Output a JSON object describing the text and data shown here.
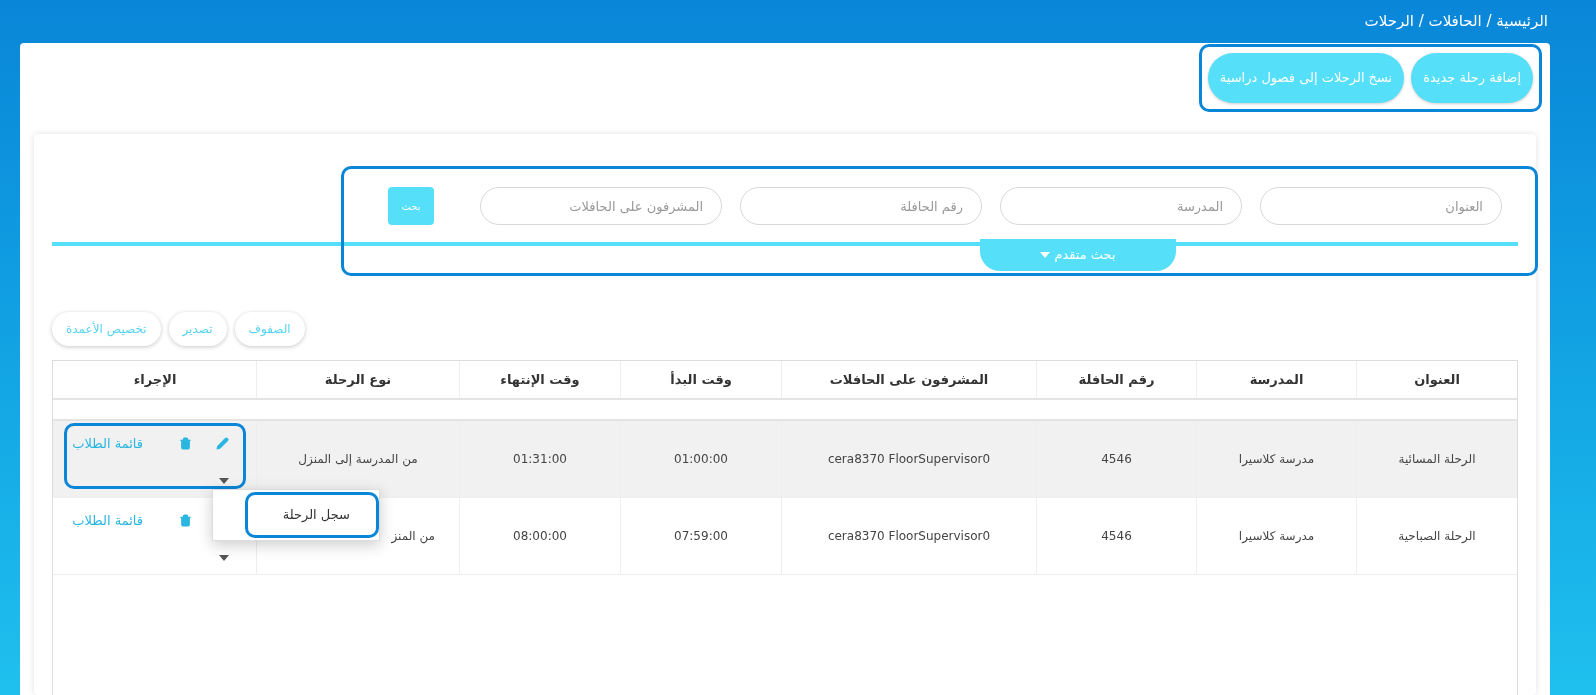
{
  "breadcrumb": "الرئيسية / الحافلات / الرحلات",
  "top_actions": {
    "highlighted": true,
    "buttons": [
      "إضافة رحلة جديدة",
      "نسخ الرحلات إلى فصول دراسية"
    ]
  },
  "search": {
    "highlighted": true,
    "fields": [
      {
        "placeholder": "العنوان"
      },
      {
        "placeholder": "المدرسة"
      },
      {
        "placeholder": "رقم الحافلة"
      },
      {
        "placeholder": "المشرفون على الحافلات"
      }
    ],
    "button": "بحث",
    "advanced": "بحث متقدم"
  },
  "toolbar": [
    "الصفوف",
    "تصدير",
    "تخصيص الأعمدة"
  ],
  "table": {
    "columns": [
      "العنوان",
      "المدرسة",
      "رقم الحافلة",
      "المشرفون على الحافلات",
      "وقت البدأ",
      "وقت الإنتهاء",
      "نوع الرحلة",
      "الإجراء"
    ],
    "rows": [
      {
        "cells": [
          "الرحلة المسائية",
          "مدرسة كلاسيرا",
          "4546",
          "cera8370 FloorSupervisor0",
          "01:00:00",
          "01:31:00",
          "من المدرسة إلى المنزل"
        ],
        "partial": false,
        "striped": true,
        "actions": {
          "highlighted": true,
          "icons": [
            {
              "kind": "edit"
            },
            {
              "kind": "delete"
            }
          ],
          "link": "قائمة الطلاب"
        }
      },
      {
        "cells": [
          "الرحلة الصباحية",
          "مدرسة كلاسيرا",
          "4546",
          "cera8370 FloorSupervisor0",
          "07:59:00",
          "08:00:00",
          "من المنز"
        ],
        "partial": true,
        "striped": false,
        "actions": {
          "highlighted": false,
          "icons": [
            {
              "kind": "delete"
            }
          ],
          "link": "قائمة الطلاب"
        }
      }
    ]
  },
  "dropdown": {
    "items": [
      {
        "label": "سجل الرحلة",
        "highlighted": true
      }
    ]
  }
}
